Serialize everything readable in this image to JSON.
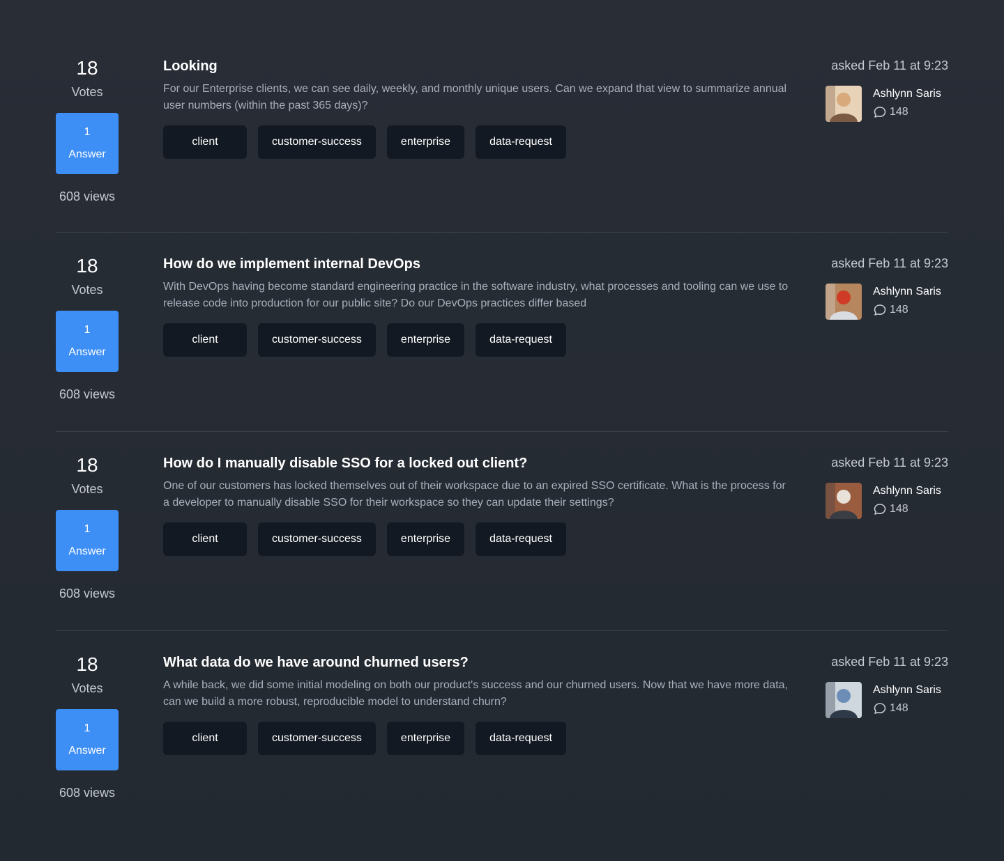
{
  "questions": [
    {
      "votes": "18",
      "votes_label": "Votes",
      "answers_count": "1",
      "answers_label": "Answer",
      "views": "608 views",
      "title": "Looking",
      "summary": "For our Enterprise clients, we can see daily, weekly, and monthly unique users. Can we expand that view to summarize annual user numbers (within the past 365 days)?",
      "tags": [
        "client",
        "customer-success",
        "enterprise",
        "data-request"
      ],
      "asked": "asked Feb 11 at 9:23",
      "author": {
        "name": "Ashlynn Saris",
        "reputation": "148",
        "avatar_icon": "avatar-photo",
        "avatar_colors": [
          "#e8d3b8",
          "#7b5a43",
          "#d7a97b"
        ]
      }
    },
    {
      "votes": "18",
      "votes_label": "Votes",
      "answers_count": "1",
      "answers_label": "Answer",
      "views": "608 views",
      "title": "How do we implement internal DevOps",
      "summary": "With DevOps having become standard engineering practice in the software industry, what processes and tooling can we use to release code into production for our public site? Do our DevOps practices differ based",
      "tags": [
        "client",
        "customer-success",
        "enterprise",
        "data-request"
      ],
      "asked": "asked Feb 11 at 9:23",
      "author": {
        "name": "Ashlynn Saris",
        "reputation": "148",
        "avatar_icon": "avatar-photo",
        "avatar_colors": [
          "#b6865f",
          "#d9dce0",
          "#cf3b26"
        ]
      }
    },
    {
      "votes": "18",
      "votes_label": "Votes",
      "answers_count": "1",
      "answers_label": "Answer",
      "views": "608 views",
      "title": "How do I manually disable SSO for a locked out client?",
      "summary": "One of our customers has locked themselves out of their workspace due to an expired SSO certificate. What is the process for a developer to manually disable SSO for their workspace so they can update their settings?",
      "tags": [
        "client",
        "customer-success",
        "enterprise",
        "data-request"
      ],
      "asked": "asked Feb 11 at 9:23",
      "author": {
        "name": "Ashlynn Saris",
        "reputation": "148",
        "avatar_icon": "avatar-photo",
        "avatar_colors": [
          "#9a5c3e",
          "#3a3d44",
          "#e7e1d8"
        ]
      }
    },
    {
      "votes": "18",
      "votes_label": "Votes",
      "answers_count": "1",
      "answers_label": "Answer",
      "views": "608 views",
      "title": "What data do we have around churned users?",
      "summary": "A while back, we did some initial modeling on both our product's success and our churned users. Now that we have more data, can we build a more robust, reproducible model to understand churn?",
      "tags": [
        "client",
        "customer-success",
        "enterprise",
        "data-request"
      ],
      "asked": "asked Feb 11 at 9:23",
      "author": {
        "name": "Ashlynn Saris",
        "reputation": "148",
        "avatar_icon": "avatar-photo",
        "avatar_colors": [
          "#cfd7df",
          "#2f3a49",
          "#6c8eb6"
        ]
      }
    }
  ],
  "icons": {
    "comment": "comment-icon"
  },
  "colors": {
    "background": "#252b33",
    "accent": "#3d8ef5",
    "tag_background": "#131922",
    "divider": "#3a414c"
  }
}
